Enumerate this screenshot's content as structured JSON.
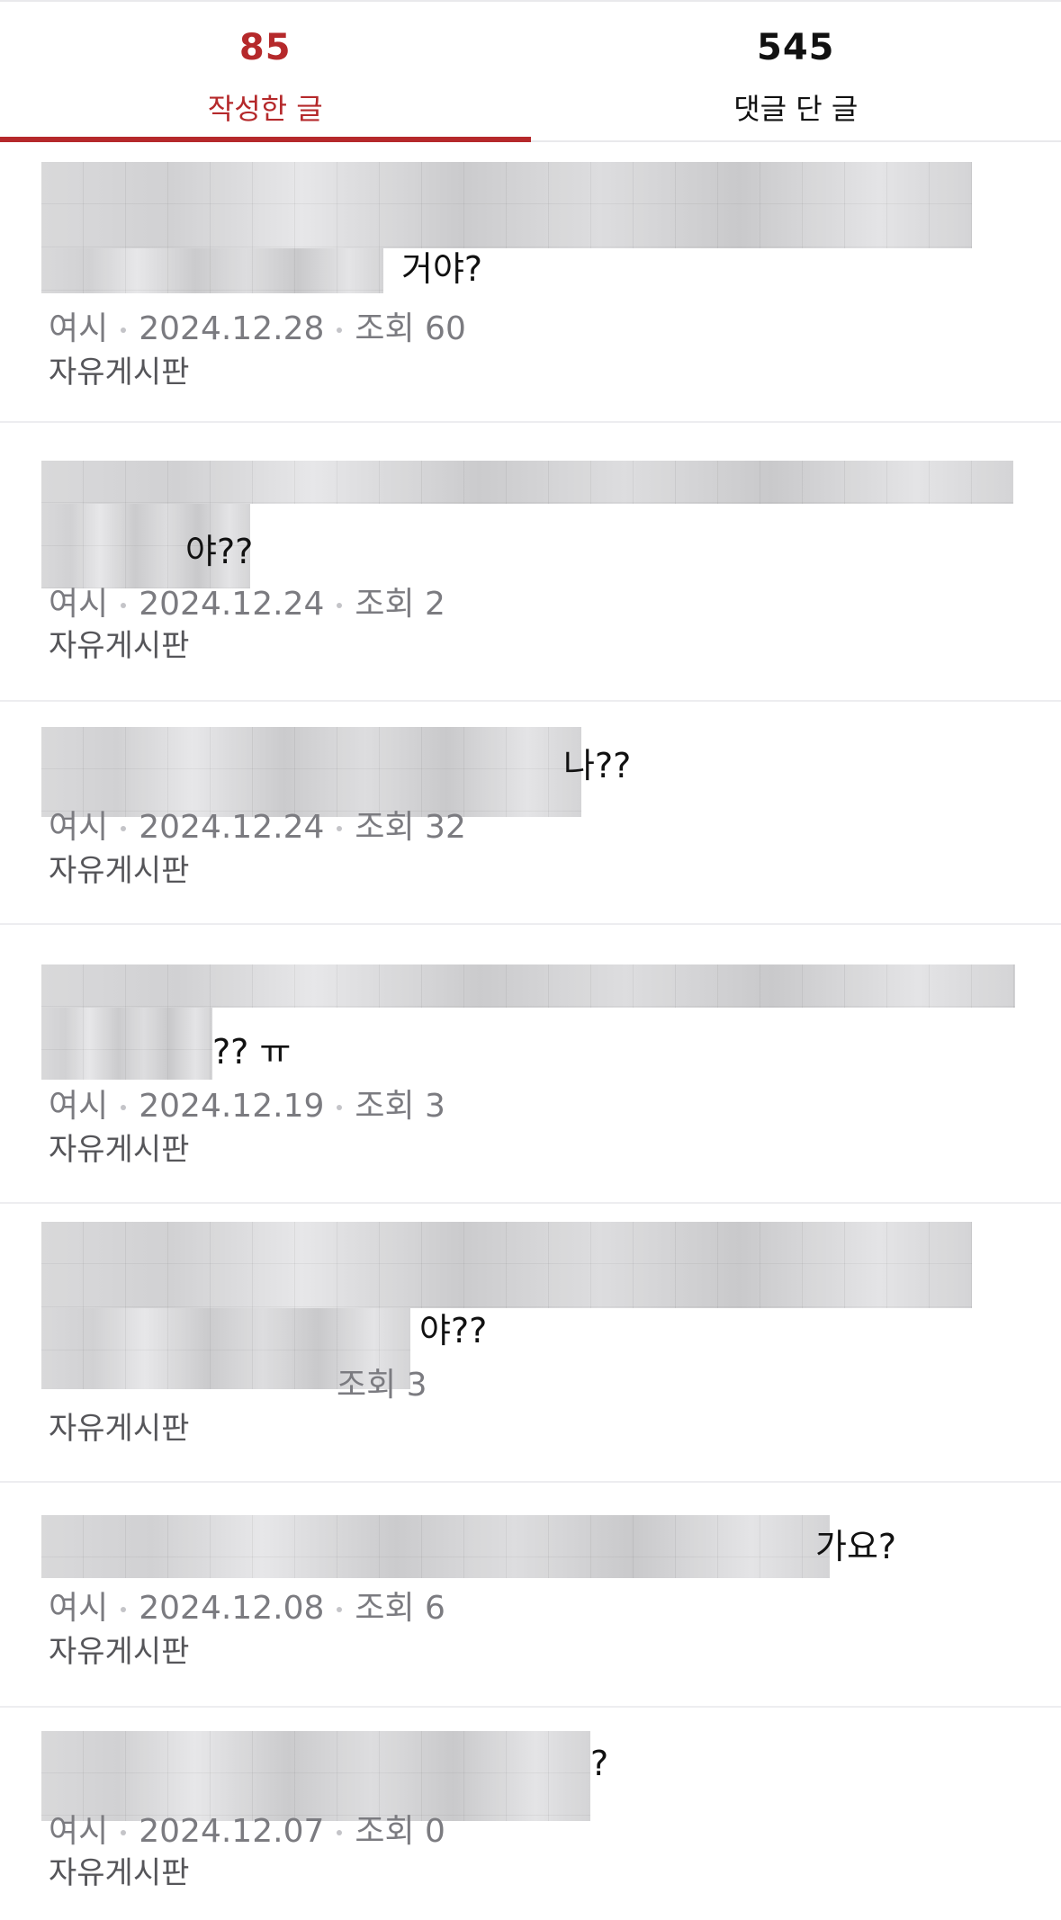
{
  "tabs": [
    {
      "count": "85",
      "label": "작성한 글",
      "active": true
    },
    {
      "count": "545",
      "label": "댓글 단 글",
      "active": false
    }
  ],
  "posts": [
    {
      "title_visible": "거야?",
      "author": "여시",
      "date": "2024.12.28",
      "views": "조회 60",
      "board": "자유게시판"
    },
    {
      "title_visible": "야??",
      "author": "여시",
      "date": "2024.12.24",
      "views": "조회 2",
      "board": "자유게시판"
    },
    {
      "title_visible": "나??",
      "author": "여시",
      "date": "2024.12.24",
      "views": "조회 32",
      "board": "자유게시판"
    },
    {
      "title_visible": "?? ㅠ",
      "author": "여시",
      "date": "2024.12.19",
      "views": "조회 3",
      "board": "자유게시판"
    },
    {
      "title_visible": "야??",
      "author": "",
      "date": "",
      "views": "조회 3",
      "board": "자유게시판"
    },
    {
      "title_visible": "가요?",
      "author": "여시",
      "date": "2024.12.08",
      "views": "조회 6",
      "board": "자유게시판"
    },
    {
      "title_visible": "?",
      "author": "여시",
      "date": "2024.12.07",
      "views": "조회 0",
      "board": "자유게시판"
    }
  ]
}
